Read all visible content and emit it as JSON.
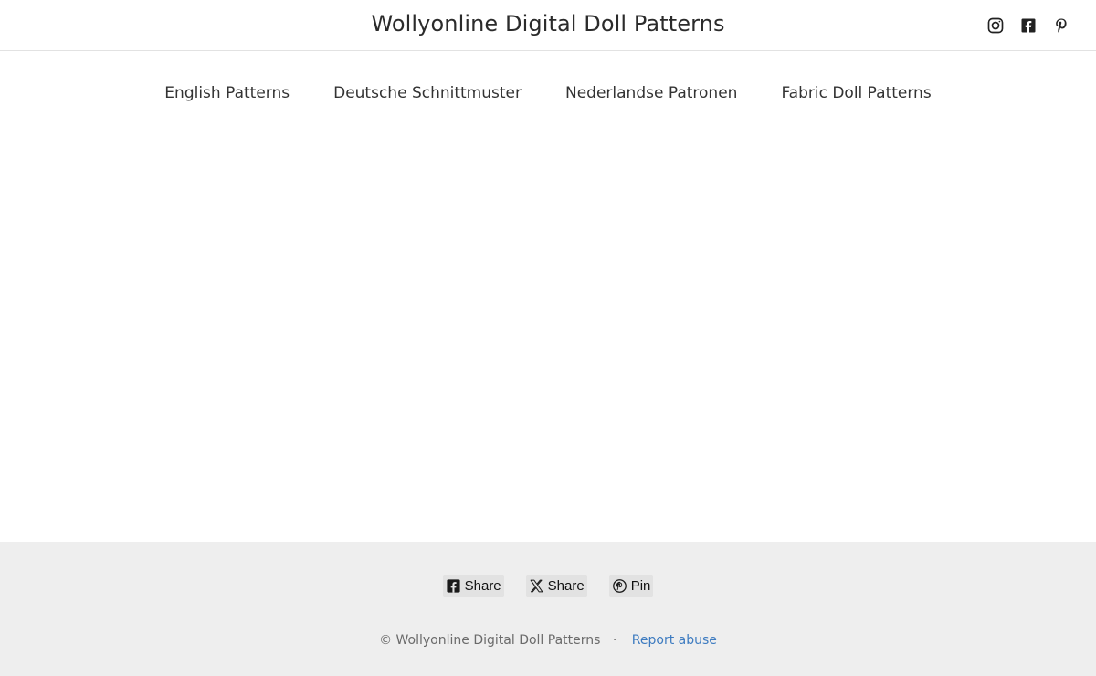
{
  "header": {
    "site_title": "Wollyonline Digital Doll Patterns",
    "social": [
      {
        "name": "instagram-icon"
      },
      {
        "name": "facebook-icon"
      },
      {
        "name": "pinterest-icon"
      }
    ]
  },
  "nav": {
    "items": [
      {
        "label": "English Patterns"
      },
      {
        "label": "Deutsche Schnittmuster"
      },
      {
        "label": "Nederlandse Patronen"
      },
      {
        "label": "Fabric Doll Patterns"
      }
    ]
  },
  "footer": {
    "share": [
      {
        "label": "Share",
        "icon": "facebook-icon"
      },
      {
        "label": "Share",
        "icon": "x-icon"
      },
      {
        "label": "Pin",
        "icon": "pinterest-icon"
      }
    ],
    "copyright": "© Wollyonline Digital Doll Patterns",
    "separator": "·",
    "report_abuse": "Report abuse",
    "link_color": "#3d7bc0",
    "background": "#eeeeee"
  }
}
